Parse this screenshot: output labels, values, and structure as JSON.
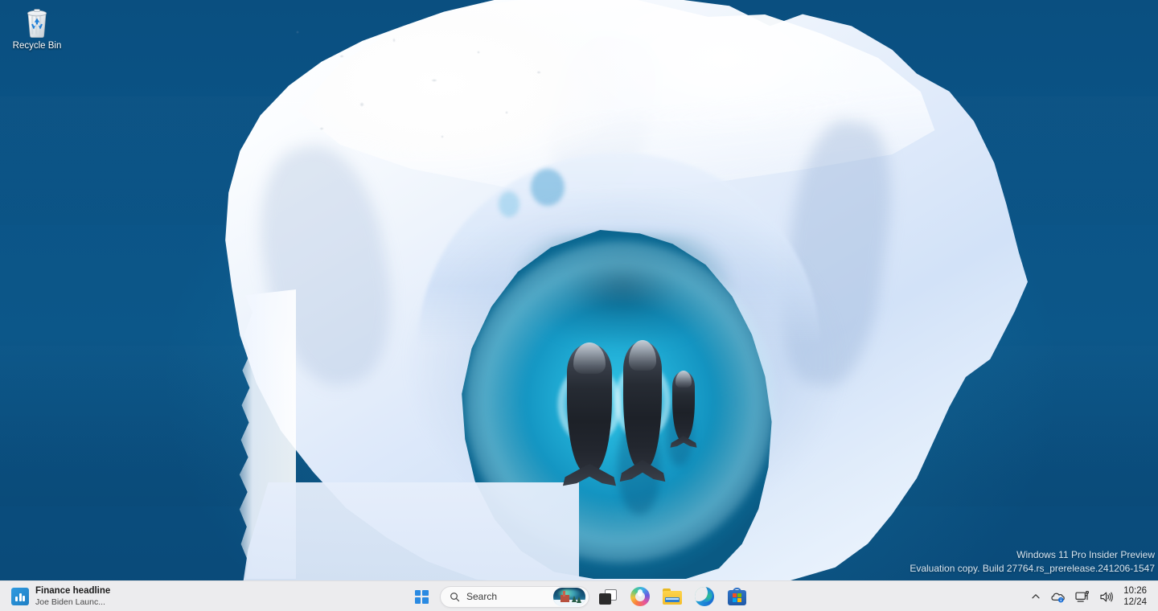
{
  "desktop": {
    "wallpaper": {
      "description": "Aerial photo of an iceberg with a horseshoe-shaped turquoise lagoon containing three bowhead whales, surrounded by deep blue ocean",
      "ocean_color": "#0b5385",
      "lagoon_color": "#21aed6",
      "ice_color": "#eef4fc"
    },
    "icons": [
      {
        "name": "recycle-bin",
        "label": "Recycle Bin",
        "icon": "recycle-bin-icon"
      }
    ]
  },
  "watermark": {
    "line1": "Windows 11 Pro Insider Preview",
    "line2": "Evaluation copy. Build 27764.rs_prerelease.241206-1547"
  },
  "taskbar": {
    "background_color": "#ececee",
    "widgets": {
      "icon": "finance-chart-icon",
      "title": "Finance headline",
      "subtitle": "Joe Biden Launc..."
    },
    "start": {
      "label": "Start",
      "icon": "windows-logo-icon"
    },
    "search": {
      "placeholder": "Search",
      "value": "Search",
      "icon": "search-icon",
      "thumbnail": "winter-church-aurora-thumbnail"
    },
    "apps": [
      {
        "name": "task-view",
        "label": "Task View",
        "icon": "task-view-icon"
      },
      {
        "name": "copilot",
        "label": "Copilot",
        "icon": "copilot-icon"
      },
      {
        "name": "file-explorer",
        "label": "File Explorer",
        "icon": "folder-icon"
      },
      {
        "name": "microsoft-edge",
        "label": "Microsoft Edge",
        "icon": "edge-icon"
      },
      {
        "name": "microsoft-store",
        "label": "Microsoft Store",
        "icon": "store-icon"
      }
    ],
    "tray": {
      "overflow": {
        "label": "Show hidden icons",
        "icon": "chevron-up-icon"
      },
      "items": [
        {
          "name": "onedrive",
          "label": "OneDrive",
          "icon": "cloud-info-icon"
        },
        {
          "name": "network",
          "label": "Network",
          "icon": "monitor-network-icon"
        },
        {
          "name": "volume",
          "label": "Volume",
          "icon": "speaker-icon"
        }
      ],
      "clock": {
        "time": "10:26",
        "date": "12/24"
      }
    }
  }
}
